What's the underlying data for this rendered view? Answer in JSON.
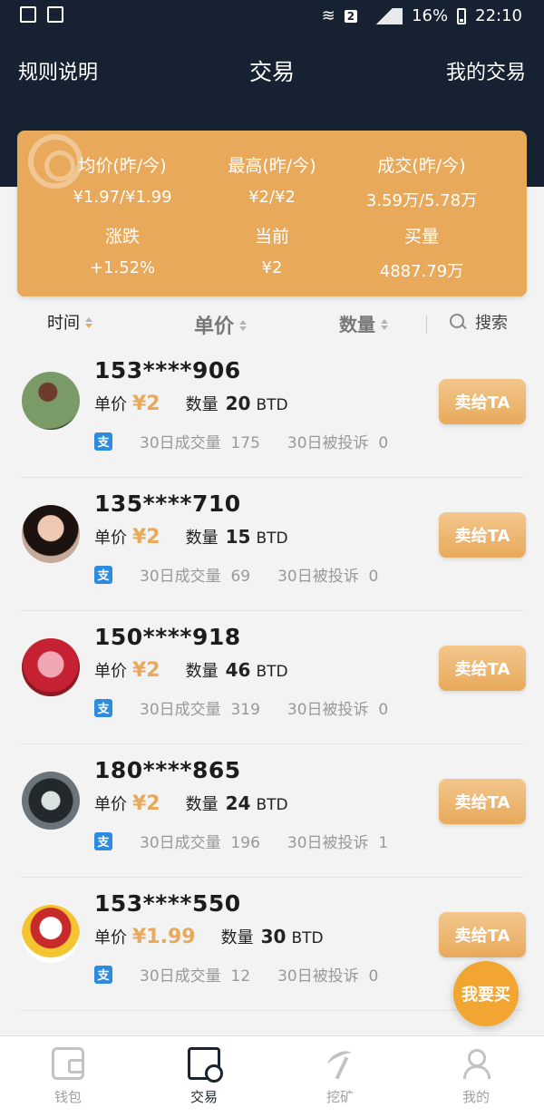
{
  "status": {
    "battery": "16%",
    "time": "22:10",
    "badge": "2"
  },
  "nav": {
    "left": "规则说明",
    "title": "交易",
    "right": "我的交易"
  },
  "stats": [
    {
      "label": "均价(昨/今)",
      "value": "¥1.97/¥1.99"
    },
    {
      "label": "最高(昨/今)",
      "value": "¥2/¥2"
    },
    {
      "label": "成交(昨/今)",
      "value": "3.59万/5.78万"
    },
    {
      "label": "涨跌",
      "value": "+1.52%"
    },
    {
      "label": "当前",
      "value": "¥2"
    },
    {
      "label": "买量",
      "value": "4887.79万"
    }
  ],
  "sort": {
    "time": "时间",
    "price": "单价",
    "qty": "数量",
    "search": "搜索"
  },
  "labels": {
    "price": "单价",
    "qty": "数量",
    "unit": "BTD",
    "vol30": "30日成交量",
    "complaints30": "30日被投诉",
    "sell": "卖给TA",
    "pay_icon": "支"
  },
  "listings": [
    {
      "user": "153****906",
      "price": "¥2",
      "qty": "20",
      "volume": "175",
      "complaints": "0"
    },
    {
      "user": "135****710",
      "price": "¥2",
      "qty": "15",
      "volume": "69",
      "complaints": "0"
    },
    {
      "user": "150****918",
      "price": "¥2",
      "qty": "46",
      "volume": "319",
      "complaints": "0"
    },
    {
      "user": "180****865",
      "price": "¥2",
      "qty": "24",
      "volume": "196",
      "complaints": "1"
    },
    {
      "user": "153****550",
      "price": "¥1.99",
      "qty": "30",
      "volume": "12",
      "complaints": "0"
    }
  ],
  "fab": "我要买",
  "tabs": [
    {
      "label": "钱包",
      "icon": "wallet-icon"
    },
    {
      "label": "交易",
      "icon": "trade-icon"
    },
    {
      "label": "挖矿",
      "icon": "pickaxe-icon"
    },
    {
      "label": "我的",
      "icon": "user-icon"
    }
  ],
  "colors": {
    "header": "#162232",
    "accent": "#e8a95b",
    "pay": "#2d8ce0"
  }
}
